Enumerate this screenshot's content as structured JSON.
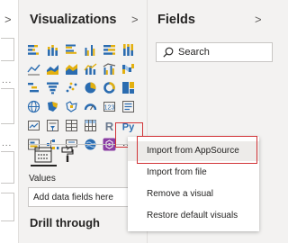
{
  "left_pane": {
    "chevron": ">",
    "more": "..."
  },
  "visualizations_pane": {
    "title": "Visualizations",
    "chevron": ">",
    "more_button": "...",
    "tabs": [
      "fields-tab",
      "format-tab"
    ],
    "values_label": "Values",
    "dropzone_text": "Add data fields here",
    "drillthrough_title": "Drill through"
  },
  "fields_pane": {
    "title": "Fields",
    "chevron": ">",
    "search_placeholder": "Search"
  },
  "context_menu": {
    "items": [
      {
        "label": "Import from AppSource"
      },
      {
        "label": "Import from file"
      },
      {
        "label": "Remove a visual"
      },
      {
        "label": "Restore default visuals"
      }
    ]
  },
  "colors": {
    "highlight": "#d13438",
    "accent_purple": "#8a3ea3",
    "icon_blue": "#2b6cb0",
    "icon_yellow": "#e3b00f"
  },
  "viz_icons": [
    "stacked-bar-chart-icon",
    "stacked-column-chart-icon",
    "clustered-bar-chart-icon",
    "clustered-column-chart-icon",
    "100-stacked-bar-chart-icon",
    "100-stacked-column-chart-icon",
    "line-chart-icon",
    "area-chart-icon",
    "stacked-area-chart-icon",
    "line-column-chart-icon",
    "line-clustered-column-chart-icon",
    "ribbon-chart-icon",
    "waterfall-chart-icon",
    "funnel-chart-icon",
    "scatter-chart-icon",
    "pie-chart-icon",
    "donut-chart-icon",
    "treemap-icon",
    "map-icon",
    "filled-map-icon",
    "shape-map-icon",
    "gauge-icon",
    "card-icon",
    "multi-row-card-icon",
    "kpi-icon",
    "slicer-icon",
    "table-icon",
    "matrix-icon",
    "r-visual-icon",
    "python-visual-icon",
    "key-influencers-icon",
    "decomposition-tree-icon",
    "qa-icon",
    "arcgis-map-icon",
    "powerapps-icon"
  ]
}
